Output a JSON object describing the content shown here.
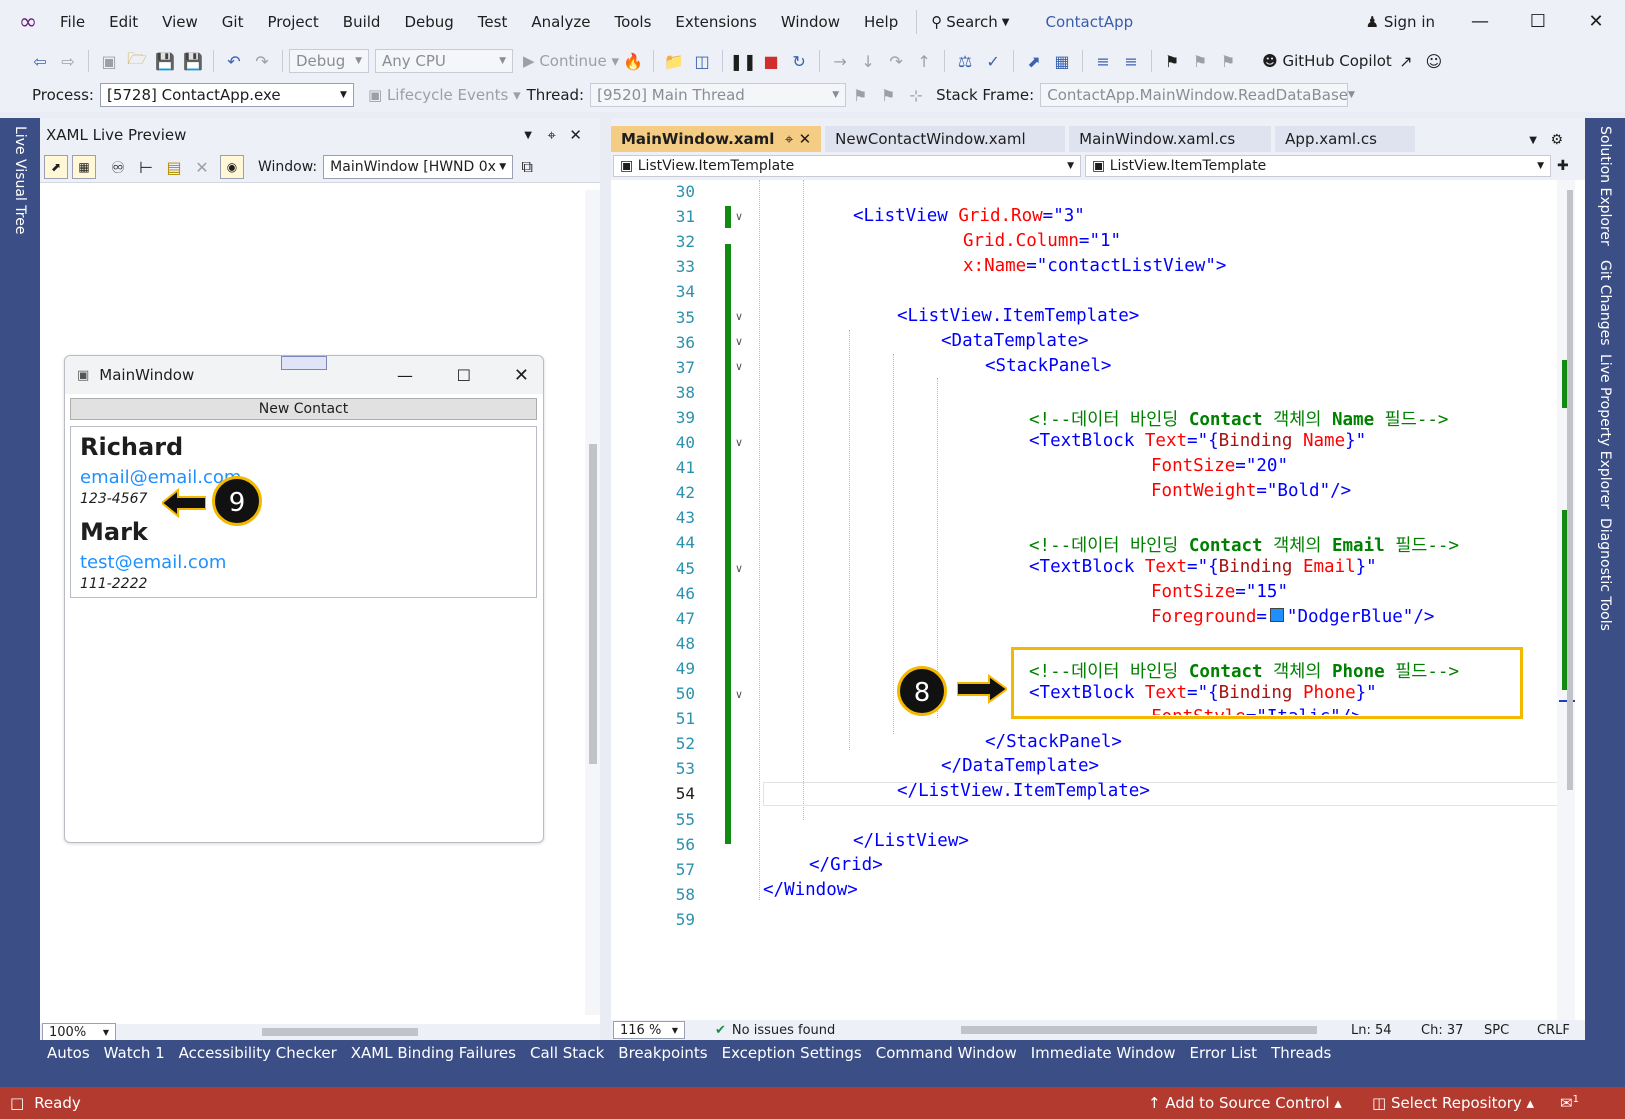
{
  "menu": [
    "File",
    "Edit",
    "View",
    "Git",
    "Project",
    "Build",
    "Debug",
    "Test",
    "Analyze",
    "Tools",
    "Extensions",
    "Window",
    "Help"
  ],
  "search_label": "Search",
  "app_title": "ContactApp",
  "sign_in": "Sign in",
  "toolbar": {
    "config": "Debug",
    "platform": "Any CPU",
    "continue": "Continue",
    "copilot": "GitHub Copilot"
  },
  "debugbar": {
    "process_label": "Process:",
    "process_value": "[5728] ContactApp.exe",
    "lifecycle": "Lifecycle Events",
    "thread_label": "Thread:",
    "thread_value": "[9520] Main Thread",
    "stack_label": "Stack Frame:",
    "stack_value": "ContactApp.MainWindow.ReadDataBase"
  },
  "left_strip": "Live Visual Tree",
  "live_preview": {
    "title": "XAML Live Preview",
    "window_label": "Window:",
    "window_value": "MainWindow [HWND 0x",
    "zoom": "100%"
  },
  "mini_window": {
    "title": "MainWindow",
    "button": "New Contact",
    "contacts": [
      {
        "name": "Richard",
        "email": "email@email.com",
        "phone": "123-4567"
      },
      {
        "name": "Mark",
        "email": "test@email.com",
        "phone": "111-2222"
      }
    ]
  },
  "callouts": {
    "a": "9",
    "b": "8"
  },
  "tabs": [
    "MainWindow.xaml",
    "NewContactWindow.xaml",
    "MainWindow.xaml.cs",
    "App.xaml.cs"
  ],
  "nav": {
    "left": "ListView.ItemTemplate",
    "right": "ListView.ItemTemplate"
  },
  "lines": [
    "30",
    "31",
    "32",
    "33",
    "34",
    "35",
    "36",
    "37",
    "38",
    "39",
    "40",
    "41",
    "42",
    "43",
    "44",
    "45",
    "46",
    "47",
    "48",
    "49",
    "50",
    "51",
    "52",
    "53",
    "54",
    "55",
    "56",
    "57",
    "58",
    "59"
  ],
  "code": {
    "l31a": "<ListView",
    "l31b": " Grid.Row",
    "l31c": "=\"3\"",
    "l32a": "Grid.Column",
    "l32b": "=\"1\"",
    "l33a": "x:Name",
    "l33b": "=\"contactListView\"",
    "l33c": ">",
    "l35": "<ListView.ItemTemplate>",
    "l36": "<DataTemplate>",
    "l37": "<StackPanel>",
    "l39a": "<!--데이터 바인딩 ",
    "l39b": "Contact",
    "l39c": " 객체의 ",
    "l39d": "Name",
    "l39e": " 필드-->",
    "l40a": "<TextBlock",
    "l40b": " Text",
    "l40c": "=\"{",
    "l40d": "Binding",
    "l40e": " Name",
    "l40f": "}\"",
    "l41a": "FontSize",
    "l41b": "=\"20\"",
    "l42a": "FontWeight",
    "l42b": "=\"Bold\"",
    "l42c": "/>",
    "l44a": "<!--데이터 바인딩 ",
    "l44b": "Contact",
    "l44c": " 객체의 ",
    "l44d": "Email",
    "l44e": " 필드-->",
    "l45a": "<TextBlock",
    "l45b": " Text",
    "l45c": "=\"{",
    "l45d": "Binding",
    "l45e": " Email",
    "l45f": "}\"",
    "l46a": "FontSize",
    "l46b": "=\"15\"",
    "l47a": "Foreground",
    "l47b": "=",
    "l47c": "\"DodgerBlue\"",
    "l47d": "/>",
    "l49a": "<!--데이터 바인딩 ",
    "l49b": "Contact",
    "l49c": " 객체의 ",
    "l49d": "Phone",
    "l49e": " 필드-->",
    "l50a": "<TextBlock",
    "l50b": " Text",
    "l50c": "=\"{",
    "l50d": "Binding",
    "l50e": " Phone",
    "l50f": "}\"",
    "l51a": "FontStyle",
    "l51b": "=\"Italic\"",
    "l51c": "/>",
    "l52": "</StackPanel>",
    "l53": "</DataTemplate>",
    "l54": "</ListView.ItemTemplate>",
    "l56": "</ListView>",
    "l57": "</Grid>",
    "l58": "</Window>"
  },
  "editor_status": {
    "zoom": "116 %",
    "issues": "No issues found",
    "ln": "Ln: 54",
    "ch": "Ch: 37",
    "spc": "SPC",
    "crlf": "CRLF"
  },
  "right_strip": [
    "Solution Explorer",
    "Git Changes",
    "Live Property Explorer",
    "Diagnostic Tools"
  ],
  "bottom_tabs": [
    "Autos",
    "Watch 1",
    "Accessibility Checker",
    "XAML Binding Failures",
    "Call Stack",
    "Breakpoints",
    "Exception Settings",
    "Command Window",
    "Immediate Window",
    "Error List",
    "Threads"
  ],
  "status": {
    "ready": "Ready",
    "source": "Add to Source Control",
    "repo": "Select Repository",
    "notif": "1"
  }
}
